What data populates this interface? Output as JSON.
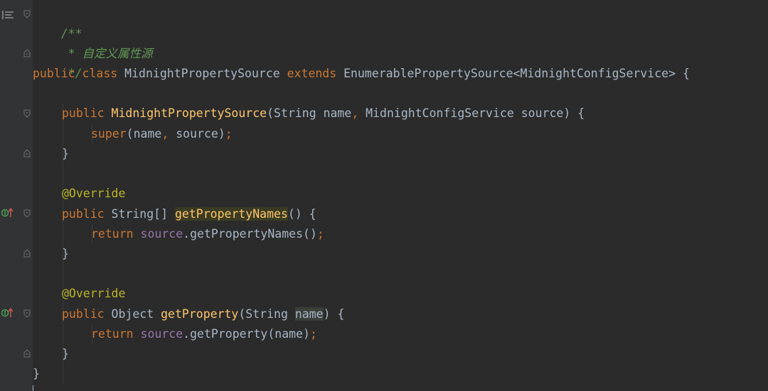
{
  "editor": {
    "lines": {
      "l1": {
        "open": "/**"
      },
      "l2": {
        "text": " * 自定义属性源"
      },
      "l3": {
        "text": " */"
      },
      "l4": {
        "public": "public",
        "class": "class",
        "name": "MidnightPropertySource",
        "extends": "extends",
        "super": "EnumerablePropertySource<MidnightConfigService> {"
      },
      "l6": {
        "public": "public",
        "ctor": "MidnightPropertySource",
        "p1": "(String name",
        "comma": ",",
        "p2": " MidnightConfigService source) {"
      },
      "l7": {
        "super": "super",
        "args1": "(name",
        "comma": ",",
        "args2": " source)",
        "semi": ";"
      },
      "l8": {
        "close": "}"
      },
      "l10": {
        "annotation": "@Override"
      },
      "l11": {
        "public": "public",
        "type": "String[]",
        "method": "getPropertyNames",
        "rest": "() {"
      },
      "l12": {
        "return": "return",
        "field": "source",
        "call": ".getPropertyNames()",
        "semi": ";"
      },
      "l13": {
        "close": "}"
      },
      "l15": {
        "annotation": "@Override"
      },
      "l16": {
        "public": "public",
        "type": "Object",
        "method": "getProperty",
        "p1": "(String ",
        "param": "name",
        "rest": ") {"
      },
      "l17": {
        "return": "return",
        "field": "source",
        "call": ".getProperty(name)",
        "semi": ";"
      },
      "l18": {
        "close": "}"
      },
      "l19": {
        "close": "}"
      }
    }
  },
  "colors": {
    "background": "#2b2b2b",
    "gutter": "#313335",
    "keyword": "#cc7832",
    "default_text": "#a9b7c6",
    "doc_comment": "#629755",
    "method_decl": "#ffc66d",
    "field": "#9876aa",
    "annotation": "#bbb529"
  },
  "icons": {
    "structure": "structure-list-icon",
    "override": "override-method-icon",
    "fold": "fold-marker-icon"
  }
}
